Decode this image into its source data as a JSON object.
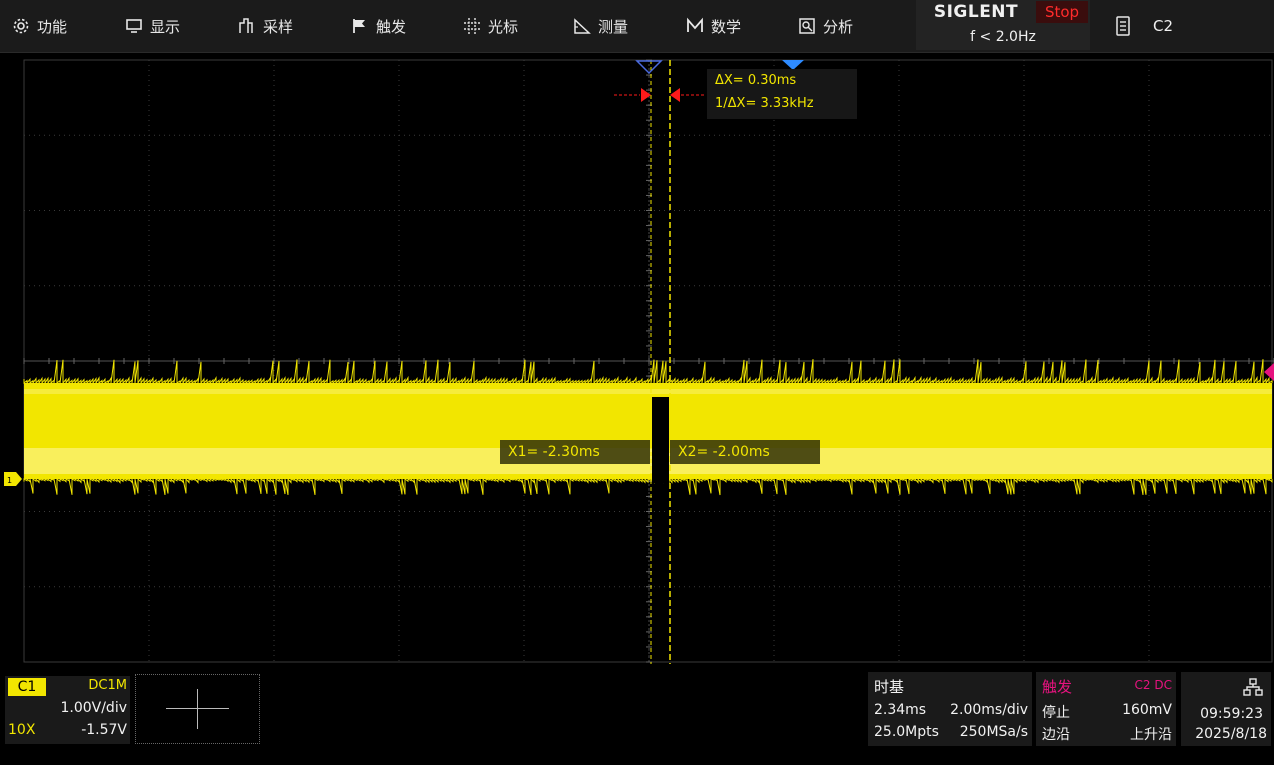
{
  "menu": {
    "items": [
      {
        "label": "功能",
        "icon": "gear-icon"
      },
      {
        "label": "显示",
        "icon": "monitor-icon"
      },
      {
        "label": "采样",
        "icon": "acquire-icon"
      },
      {
        "label": "触发",
        "icon": "flag-icon"
      },
      {
        "label": "光标",
        "icon": "cursor-icon"
      },
      {
        "label": "测量",
        "icon": "measure-icon"
      },
      {
        "label": "数学",
        "icon": "math-icon"
      },
      {
        "label": "分析",
        "icon": "analysis-icon"
      }
    ]
  },
  "status": {
    "brand": "SIGLENT",
    "run_state": "Stop",
    "trigger_freq": "f < 2.0Hz",
    "active_channel": "C2"
  },
  "cursors": {
    "delta_x": "ΔX= 0.30ms",
    "inv_delta_x": "1/ΔX= 3.33kHz",
    "x1": "X1= -2.30ms",
    "x2": "X2= -2.00ms"
  },
  "channel1": {
    "tag": "C1",
    "coupling": "DC1M",
    "scale": "1.00V/div",
    "probe": "10X",
    "offset": "-1.57V"
  },
  "timebase": {
    "title": "时基",
    "delay": "2.34ms",
    "scale": "2.00ms/div",
    "depth": "25.0Mpts",
    "rate": "250MSa/s"
  },
  "trigger": {
    "title": "触发",
    "source": "C2 DC",
    "mode": "停止",
    "level": "160mV",
    "type": "边沿",
    "slope": "上升沿"
  },
  "clock": {
    "time": "09:59:23",
    "date": "2025/8/18"
  },
  "colors": {
    "trace_c1": "#f2e600",
    "trigger": "#e6137f",
    "stop": "#ff2b2b",
    "cursor_arrow": "#ff1a1a",
    "trigger_marker": "#2e8bff"
  }
}
